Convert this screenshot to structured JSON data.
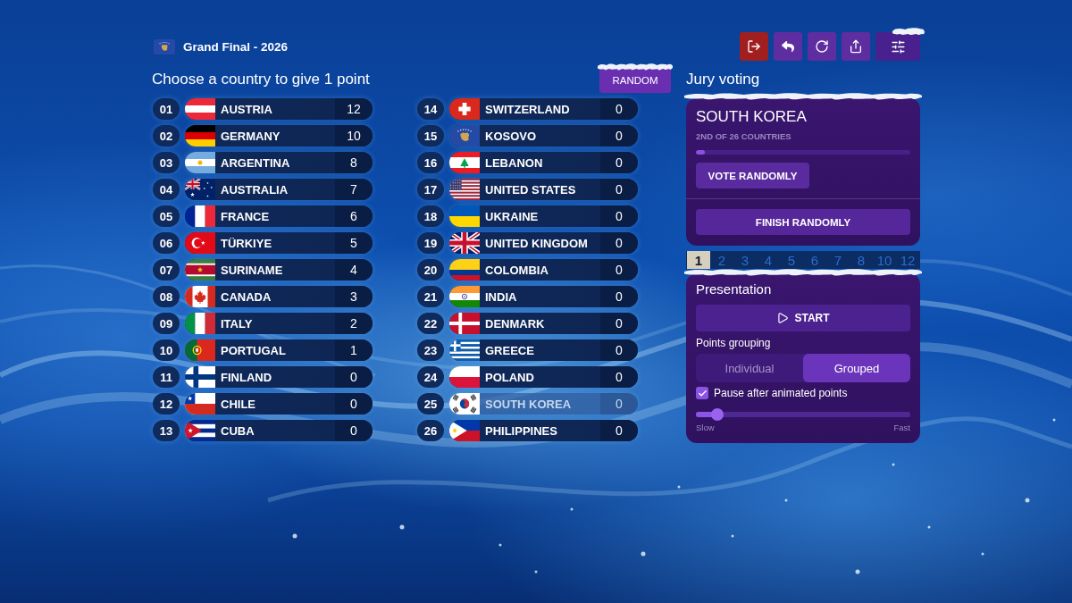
{
  "header": {
    "title": "Grand Final - 2026"
  },
  "prompt": "Choose a country to give 1 point",
  "random_button": "RANDOM",
  "countries": [
    {
      "number": "01",
      "kind": "at",
      "name": "AUSTRIA",
      "points": "12",
      "disabled": false
    },
    {
      "number": "02",
      "kind": "de",
      "name": "GERMANY",
      "points": "10",
      "disabled": false
    },
    {
      "number": "03",
      "kind": "ar",
      "name": "ARGENTINA",
      "points": "8",
      "disabled": false
    },
    {
      "number": "04",
      "kind": "au",
      "name": "AUSTRALIA",
      "points": "7",
      "disabled": false
    },
    {
      "number": "05",
      "kind": "fr",
      "name": "FRANCE",
      "points": "6",
      "disabled": false
    },
    {
      "number": "06",
      "kind": "tr",
      "name": "TÜRKIYE",
      "points": "5",
      "disabled": false
    },
    {
      "number": "07",
      "kind": "sr",
      "name": "SURINAME",
      "points": "4",
      "disabled": false
    },
    {
      "number": "08",
      "kind": "ca",
      "name": "CANADA",
      "points": "3",
      "disabled": false
    },
    {
      "number": "09",
      "kind": "it",
      "name": "ITALY",
      "points": "2",
      "disabled": false
    },
    {
      "number": "10",
      "kind": "pt",
      "name": "PORTUGAL",
      "points": "1",
      "disabled": false
    },
    {
      "number": "11",
      "kind": "fi",
      "name": "FINLAND",
      "points": "0",
      "disabled": false
    },
    {
      "number": "12",
      "kind": "cl",
      "name": "CHILE",
      "points": "0",
      "disabled": false
    },
    {
      "number": "13",
      "kind": "cu",
      "name": "CUBA",
      "points": "0",
      "disabled": false
    },
    {
      "number": "14",
      "kind": "ch",
      "name": "SWITZERLAND",
      "points": "0",
      "disabled": false
    },
    {
      "number": "15",
      "kind": "xk",
      "name": "KOSOVO",
      "points": "0",
      "disabled": false
    },
    {
      "number": "16",
      "kind": "lb",
      "name": "LEBANON",
      "points": "0",
      "disabled": false
    },
    {
      "number": "17",
      "kind": "us",
      "name": "UNITED STATES",
      "points": "0",
      "disabled": false
    },
    {
      "number": "18",
      "kind": "ua",
      "name": "UKRAINE",
      "points": "0",
      "disabled": false
    },
    {
      "number": "19",
      "kind": "gb",
      "name": "UNITED KINGDOM",
      "points": "0",
      "disabled": false
    },
    {
      "number": "20",
      "kind": "co",
      "name": "COLOMBIA",
      "points": "0",
      "disabled": false
    },
    {
      "number": "21",
      "kind": "in",
      "name": "INDIA",
      "points": "0",
      "disabled": false
    },
    {
      "number": "22",
      "kind": "dk",
      "name": "DENMARK",
      "points": "0",
      "disabled": false
    },
    {
      "number": "23",
      "kind": "gr",
      "name": "GREECE",
      "points": "0",
      "disabled": false
    },
    {
      "number": "24",
      "kind": "pl",
      "name": "POLAND",
      "points": "0",
      "disabled": false
    },
    {
      "number": "25",
      "kind": "kr",
      "name": "SOUTH KOREA",
      "points": "0",
      "disabled": true
    },
    {
      "number": "26",
      "kind": "ph",
      "name": "PHILIPPINES",
      "points": "0",
      "disabled": false
    }
  ],
  "jury": {
    "heading": "Jury voting",
    "country": "SOUTH KOREA",
    "progress_text": "2ND OF 26 COUNTRIES",
    "level": 0.04,
    "vote_button": "VOTE RANDOMLY",
    "finish_button": "FINISH RANDOMLY"
  },
  "point_tabs": [
    {
      "label": "1",
      "selected": true
    },
    {
      "label": "2",
      "selected": false
    },
    {
      "label": "3",
      "selected": false
    },
    {
      "label": "4",
      "selected": false
    },
    {
      "label": "5",
      "selected": false
    },
    {
      "label": "6",
      "selected": false
    },
    {
      "label": "7",
      "selected": false
    },
    {
      "label": "8",
      "selected": false
    },
    {
      "label": "10",
      "selected": false
    },
    {
      "label": "12",
      "selected": false
    }
  ],
  "presentation": {
    "heading": "Presentation",
    "start_button": "START",
    "grouping_label": "Points grouping",
    "grouping_options": [
      {
        "label": "Individual",
        "selected": false
      },
      {
        "label": "Grouped",
        "selected": true
      }
    ],
    "pause_checkbox": {
      "label": "Pause after animated points",
      "checked": true
    },
    "speed_slider": {
      "level": 0.1,
      "min_label": "Slow",
      "max_label": "Fast"
    }
  }
}
